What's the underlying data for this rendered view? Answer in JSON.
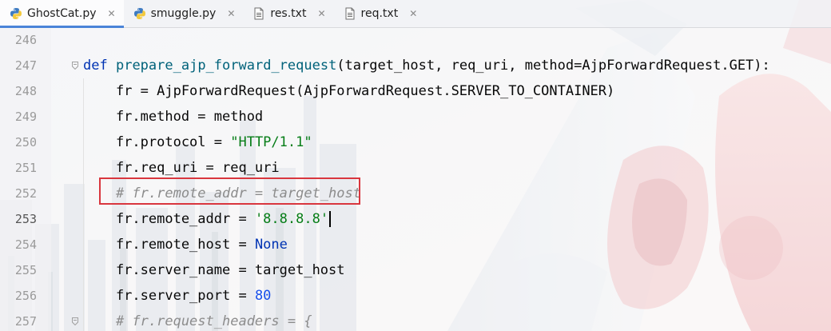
{
  "tabs": [
    {
      "label": "GhostCat.py",
      "icon": "python-file-icon",
      "active": true
    },
    {
      "label": "smuggle.py",
      "icon": "python-file-icon",
      "active": false
    },
    {
      "label": "res.txt",
      "icon": "text-file-icon",
      "active": false
    },
    {
      "label": "req.txt",
      "icon": "text-file-icon",
      "active": false
    }
  ],
  "tab_close_glyph": "✕",
  "lines": [
    {
      "number": "246"
    },
    {
      "number": "247",
      "tokens": {
        "kw_def": "def",
        "fn_name": "prepare_ajp_forward_request",
        "rest": "(target_host, req_uri, method=AjpForwardRequest.GET):"
      }
    },
    {
      "number": "248",
      "text": "    fr = AjpForwardRequest(AjpForwardRequest.SERVER_TO_CONTAINER)"
    },
    {
      "number": "249",
      "text": "    fr.method = method"
    },
    {
      "number": "250",
      "tokens": {
        "prefix": "    fr.protocol = ",
        "string": "\"HTTP/1.1\""
      }
    },
    {
      "number": "251",
      "text": "    fr.req_uri = req_uri"
    },
    {
      "number": "252",
      "comment": "    # fr.remote_addr = target_host"
    },
    {
      "number": "253",
      "tokens": {
        "prefix": "    fr.remote_addr = ",
        "string": "'8.8.8.8'"
      }
    },
    {
      "number": "254",
      "tokens": {
        "prefix": "    fr.remote_host = ",
        "keyword": "None"
      }
    },
    {
      "number": "255",
      "text": "    fr.server_name = target_host"
    },
    {
      "number": "256",
      "tokens": {
        "prefix": "    fr.server_port = ",
        "number": "80"
      }
    },
    {
      "number": "257",
      "comment": "    # fr.request_headers = {"
    }
  ],
  "colors": {
    "keyword": "#0033b3",
    "function": "#00627a",
    "string": "#067d17",
    "comment": "#8c8c8c",
    "number": "#1750eb",
    "highlight_box": "#d9363e",
    "active_tab_underline": "#4a84d8"
  }
}
